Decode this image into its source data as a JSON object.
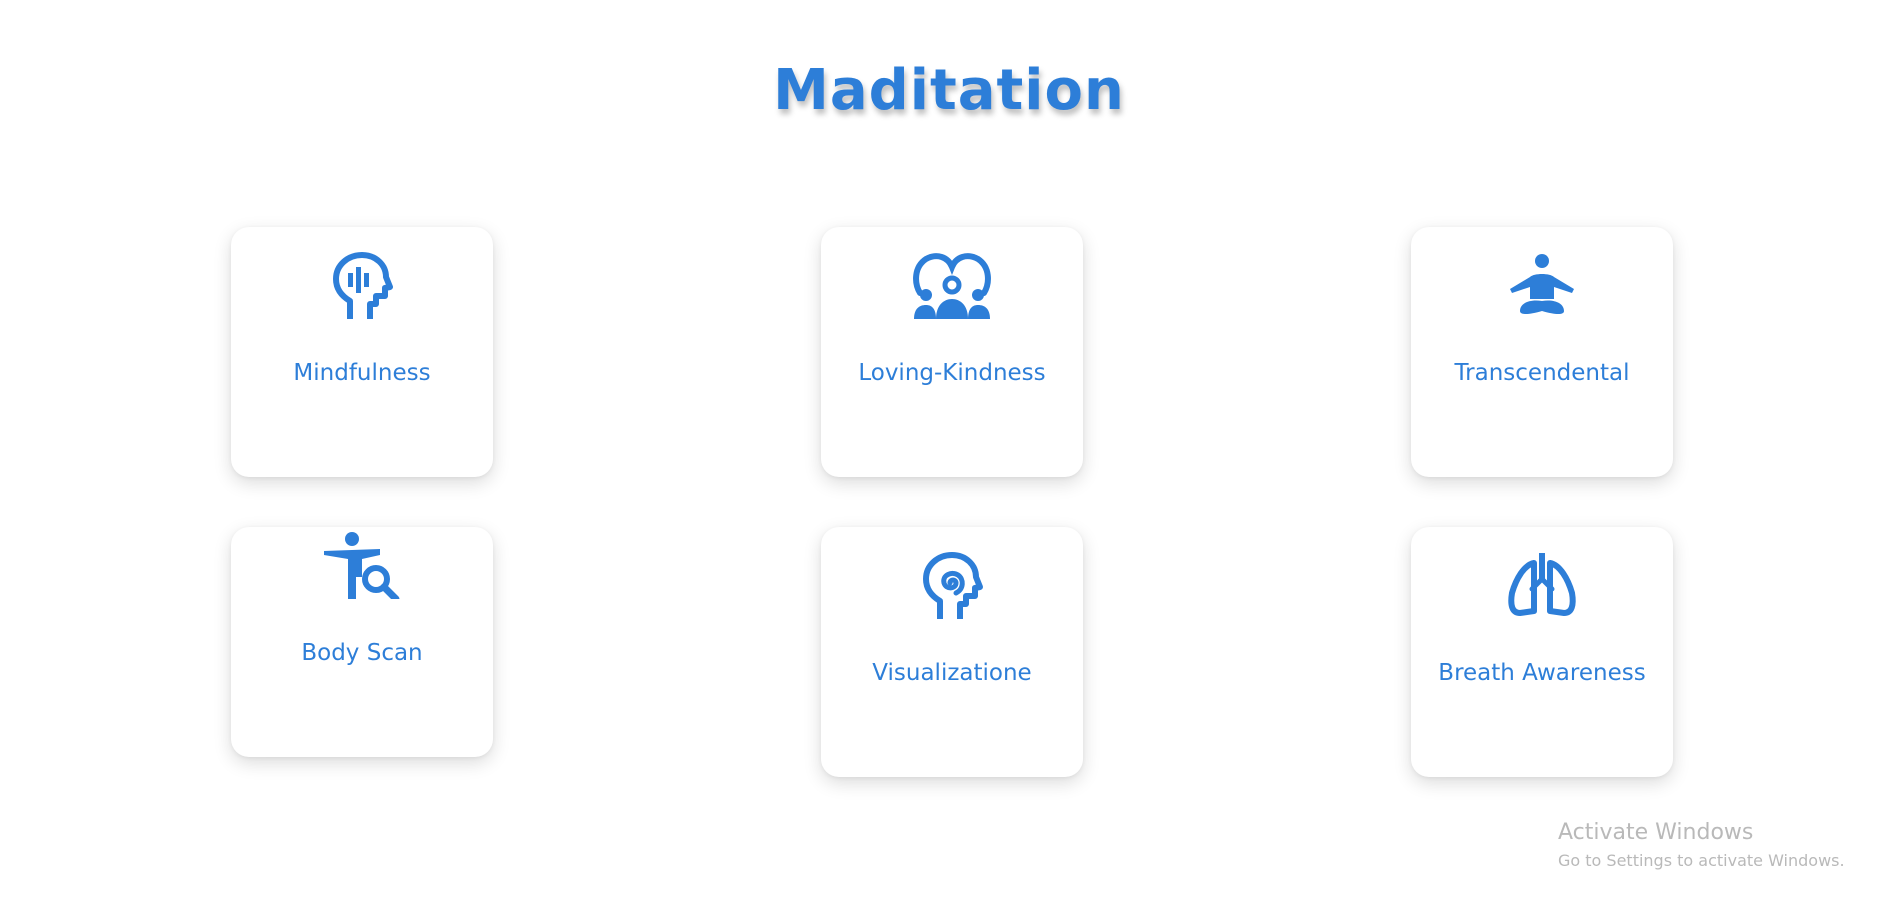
{
  "page": {
    "title": "Maditation",
    "accent_color": "#2d7ed8"
  },
  "cards": [
    {
      "label": "Mindfulness",
      "icon": "head-mind-icon"
    },
    {
      "label": "Loving-Kindness",
      "icon": "group-heart-icon"
    },
    {
      "label": "Transcendental",
      "icon": "meditation-pose-icon"
    },
    {
      "label": "Body Scan",
      "icon": "person-magnifier-icon"
    },
    {
      "label": "Visualizatione",
      "icon": "head-spiral-icon"
    },
    {
      "label": "Breath Awareness",
      "icon": "lungs-icon"
    }
  ],
  "watermark": {
    "title": "Activate Windows",
    "subtitle": "Go to Settings to activate Windows."
  }
}
